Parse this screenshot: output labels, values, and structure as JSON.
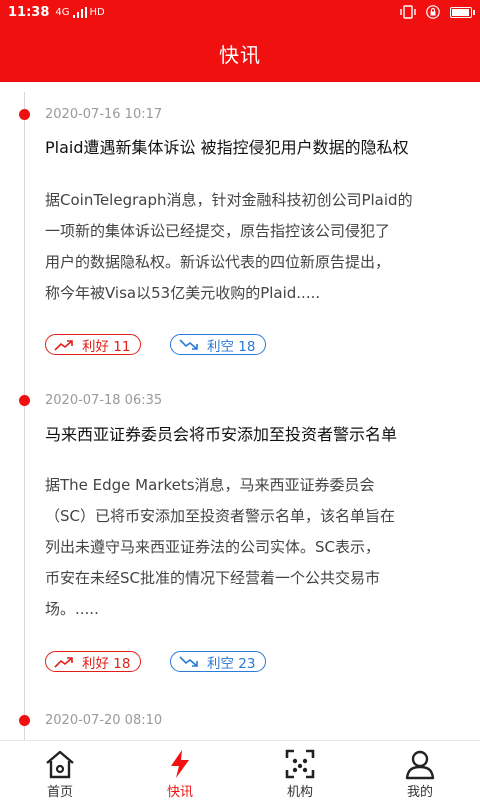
{
  "statusbar": {
    "time": "11:38",
    "signal": "4G",
    "network": "HD",
    "battery_level": 0.85
  },
  "header": {
    "title": "快讯"
  },
  "feed": [
    {
      "time": "2020-07-16 10:17",
      "title": "Plaid遭遇新集体诉讼 被指控侵犯用户数据的隐私权",
      "body_lines": [
        "据CoinTelegraph消息，针对金融科技初创公司Plaid的",
        "一项新的集体诉讼已经提交，原告指控该公司侵犯了",
        "用户的数据隐私权。新诉讼代表的四位新原告提出，",
        "称今年被Visa以53亿美元收购的Plaid....."
      ],
      "bullish": "利好 11",
      "bearish": "利空 18"
    },
    {
      "time": "2020-07-18 06:35",
      "title": "马来西亚证券委员会将币安添加至投资者警示名单",
      "body_lines": [
        "据The Edge Markets消息，马来西亚证券委员会",
        "（SC）已将币安添加至投资者警示名单，该名单旨在",
        "列出未遵守马来西亚证券法的公司实体。SC表示，",
        "币安在未经SC批准的情况下经营着一个公共交易市",
        "场。....."
      ],
      "bullish": "利好 18",
      "bearish": "利空 23"
    },
    {
      "time": "2020-07-20 08:10"
    }
  ],
  "tabs": [
    {
      "label": "首页",
      "icon": "home-icon"
    },
    {
      "label": "快讯",
      "icon": "lightning-icon"
    },
    {
      "label": "机构",
      "icon": "scan-icon"
    },
    {
      "label": "我的",
      "icon": "user-icon"
    }
  ],
  "colors": {
    "brand": "#f01010",
    "bullish": "#e0201a",
    "bearish": "#2a7ad8"
  }
}
